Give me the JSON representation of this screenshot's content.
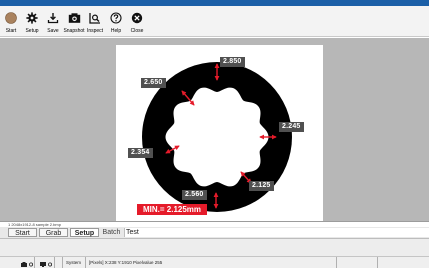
{
  "toolbar": {
    "items": [
      {
        "label": "Start",
        "icon": "start-circle-icon"
      },
      {
        "label": "Setup",
        "icon": "gear-icon"
      },
      {
        "label": "Save",
        "icon": "download-icon"
      },
      {
        "label": "Snapshot",
        "icon": "camera-icon"
      },
      {
        "label": "Inspect",
        "icon": "inspect-icon"
      },
      {
        "label": "Help",
        "icon": "help-icon"
      },
      {
        "label": "Close",
        "icon": "close-icon"
      }
    ]
  },
  "image": {
    "measurements": [
      "2.850",
      "2.650",
      "2.245",
      "2.354",
      "2.560",
      "2.125"
    ],
    "min_label": "MIN.= 2.125mm",
    "colors": {
      "ring": "#000000",
      "arrow": "#e51b2a",
      "label_bg": "#505050",
      "min_bg": "#e51b2a"
    }
  },
  "path_bar": {
    "text": "1 2048x1912-8 sample 2.bmp"
  },
  "tabs": {
    "items": [
      "Start",
      "Grab",
      "Setup",
      "Batch",
      "Test"
    ],
    "active": "Setup"
  },
  "status": {
    "system_label": "System",
    "pixel_info": "[Pixels] X:238 Y:1910 Pixelvalue 255"
  }
}
